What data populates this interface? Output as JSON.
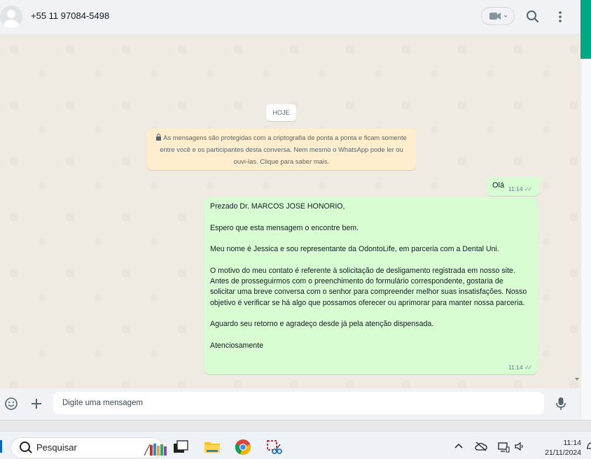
{
  "header": {
    "contact_name": "+55 11 97084-5498",
    "icons": [
      "avatar-placeholder",
      "video-camera-icon",
      "chevron-down-icon",
      "search-icon",
      "more-vertical-icon"
    ]
  },
  "chat": {
    "date_chip": "HOJE",
    "encryption_notice": "As mensagens são protegidas com a criptografia de ponta a ponta e ficam somente entre você e os participantes desta conversa. Nem mesmo o WhatsApp pode ler ou ouvi-las. Clique para saber mais.",
    "messages": [
      {
        "text": "Olá",
        "time": "11:14",
        "status": "double-check-icon"
      },
      {
        "text": "Prezado Dr.  MARCOS JOSE HONORIO,\n\nEspero que esta mensagem o encontre bem.\n\nMeu nome é Jessica e sou representante da OdontoLife, em parceria com a Dental Uni.\n\nO motivo do meu contato é referente à solicitação de desligamento registrada em nosso site.\nAntes de prosseguirmos com o preenchimento do formulário correspondente, gostaria de solicitar uma breve conversa com o senhor para compreender melhor suas insatisfações. Nosso objetivo é verificar se há algo que possamos oferecer ou aprimorar para manter nossa parceria.\n\nAguardo seu retorno e agradeço desde já pela atenção dispensada.\n\nAtenciosamente",
        "time": "11:14",
        "status": "double-check-icon"
      }
    ]
  },
  "composer": {
    "placeholder": "Digite uma mensagem",
    "icons": [
      "emoji-icon",
      "plus-icon",
      "microphone-icon"
    ]
  },
  "taskbar": {
    "search_label": "Pesquisar",
    "time": "11:14",
    "date": "21/11/2024",
    "apps": [
      "books-widget-icon",
      "task-view-icon",
      "file-explorer-icon",
      "chrome-icon",
      "snipping-tool-icon"
    ],
    "tray": [
      "chevron-up-icon",
      "cloud-off-icon",
      "network-icon",
      "speaker-icon"
    ]
  },
  "colors": {
    "accent": "#00a884",
    "outgoing_bubble": "#d9fdd3",
    "notice_bg": "#ffeecd",
    "chat_bg": "#efeae2"
  }
}
